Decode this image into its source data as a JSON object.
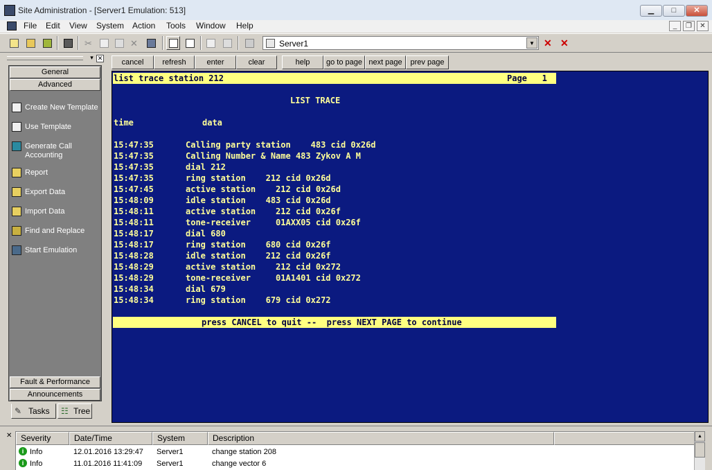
{
  "window": {
    "title": "Site Administration - [Server1 Emulation: 513]",
    "min": "▁",
    "max": "□",
    "close": "✕"
  },
  "menu": {
    "items": [
      "File",
      "Edit",
      "View",
      "System",
      "Action",
      "Tools",
      "Window",
      "Help"
    ],
    "mdi_min": "_",
    "mdi_restore": "❐",
    "mdi_close": "✕"
  },
  "toolbar": {
    "server_value": "Server1"
  },
  "left_panel": {
    "categories": {
      "general": "General",
      "advanced": "Advanced",
      "fault": "Fault & Performance",
      "announcements": "Announcements"
    },
    "tasks": [
      {
        "label": "Create New Template",
        "icon": "template-icon"
      },
      {
        "label": "Use Template",
        "icon": "template-icon"
      },
      {
        "label": "Generate Call Accounting",
        "icon": "chart-icon"
      },
      {
        "label": "Report",
        "icon": "report-icon"
      },
      {
        "label": "Export Data",
        "icon": "export-icon"
      },
      {
        "label": "Import Data",
        "icon": "import-icon"
      },
      {
        "label": "Find and Replace",
        "icon": "binoculars-icon"
      },
      {
        "label": "Start Emulation",
        "icon": "emulation-icon"
      }
    ],
    "tabs": {
      "tasks": "Tasks",
      "tree": "Tree"
    }
  },
  "commands": {
    "cancel": "cancel",
    "refresh": "refresh",
    "enter": "enter",
    "clear": "clear",
    "help": "help",
    "goto": "go to page",
    "next": "next page",
    "prev": "prev page"
  },
  "terminal": {
    "command": "list trace station 212",
    "page_label": "Page   1",
    "heading": "LIST TRACE",
    "col_time": "time",
    "col_data": "data",
    "rows": [
      {
        "time": "15:47:35",
        "data": "Calling party station    483 cid 0x26d"
      },
      {
        "time": "15:47:35",
        "data": "Calling Number & Name 483 Zykov A M"
      },
      {
        "time": "15:47:35",
        "data": "dial 212"
      },
      {
        "time": "15:47:35",
        "data": "ring station    212 cid 0x26d"
      },
      {
        "time": "15:47:45",
        "data": "active station    212 cid 0x26d"
      },
      {
        "time": "15:48:09",
        "data": "idle station    483 cid 0x26d"
      },
      {
        "time": "15:48:11",
        "data": "active station    212 cid 0x26f"
      },
      {
        "time": "15:48:11",
        "data": "tone-receiver     01AXX05 cid 0x26f"
      },
      {
        "time": "15:48:17",
        "data": "dial 680"
      },
      {
        "time": "15:48:17",
        "data": "ring station    680 cid 0x26f"
      },
      {
        "time": "15:48:28",
        "data": "idle station    212 cid 0x26f"
      },
      {
        "time": "15:48:29",
        "data": "active station    212 cid 0x272"
      },
      {
        "time": "15:48:29",
        "data": "tone-receiver     01A1401 cid 0x272"
      },
      {
        "time": "15:48:34",
        "data": "dial 679"
      },
      {
        "time": "15:48:34",
        "data": "ring station    679 cid 0x272"
      }
    ],
    "footer": "press CANCEL to quit --  press NEXT PAGE to continue"
  },
  "log": {
    "headers": {
      "severity": "Severity",
      "datetime": "Date/Time",
      "system": "System",
      "description": "Description"
    },
    "rows": [
      {
        "severity": "Info",
        "datetime": "12.01.2016 13:29:47",
        "system": "Server1",
        "description": "change station 208"
      },
      {
        "severity": "Info",
        "datetime": "11.01.2016 11:41:09",
        "system": "Server1",
        "description": "change vector 6"
      }
    ]
  },
  "colors": {
    "terminal_bg": "#0b1a80",
    "terminal_text": "#ffff99",
    "terminal_bar": "#ffff80",
    "info_green": "#1a9a1a"
  }
}
